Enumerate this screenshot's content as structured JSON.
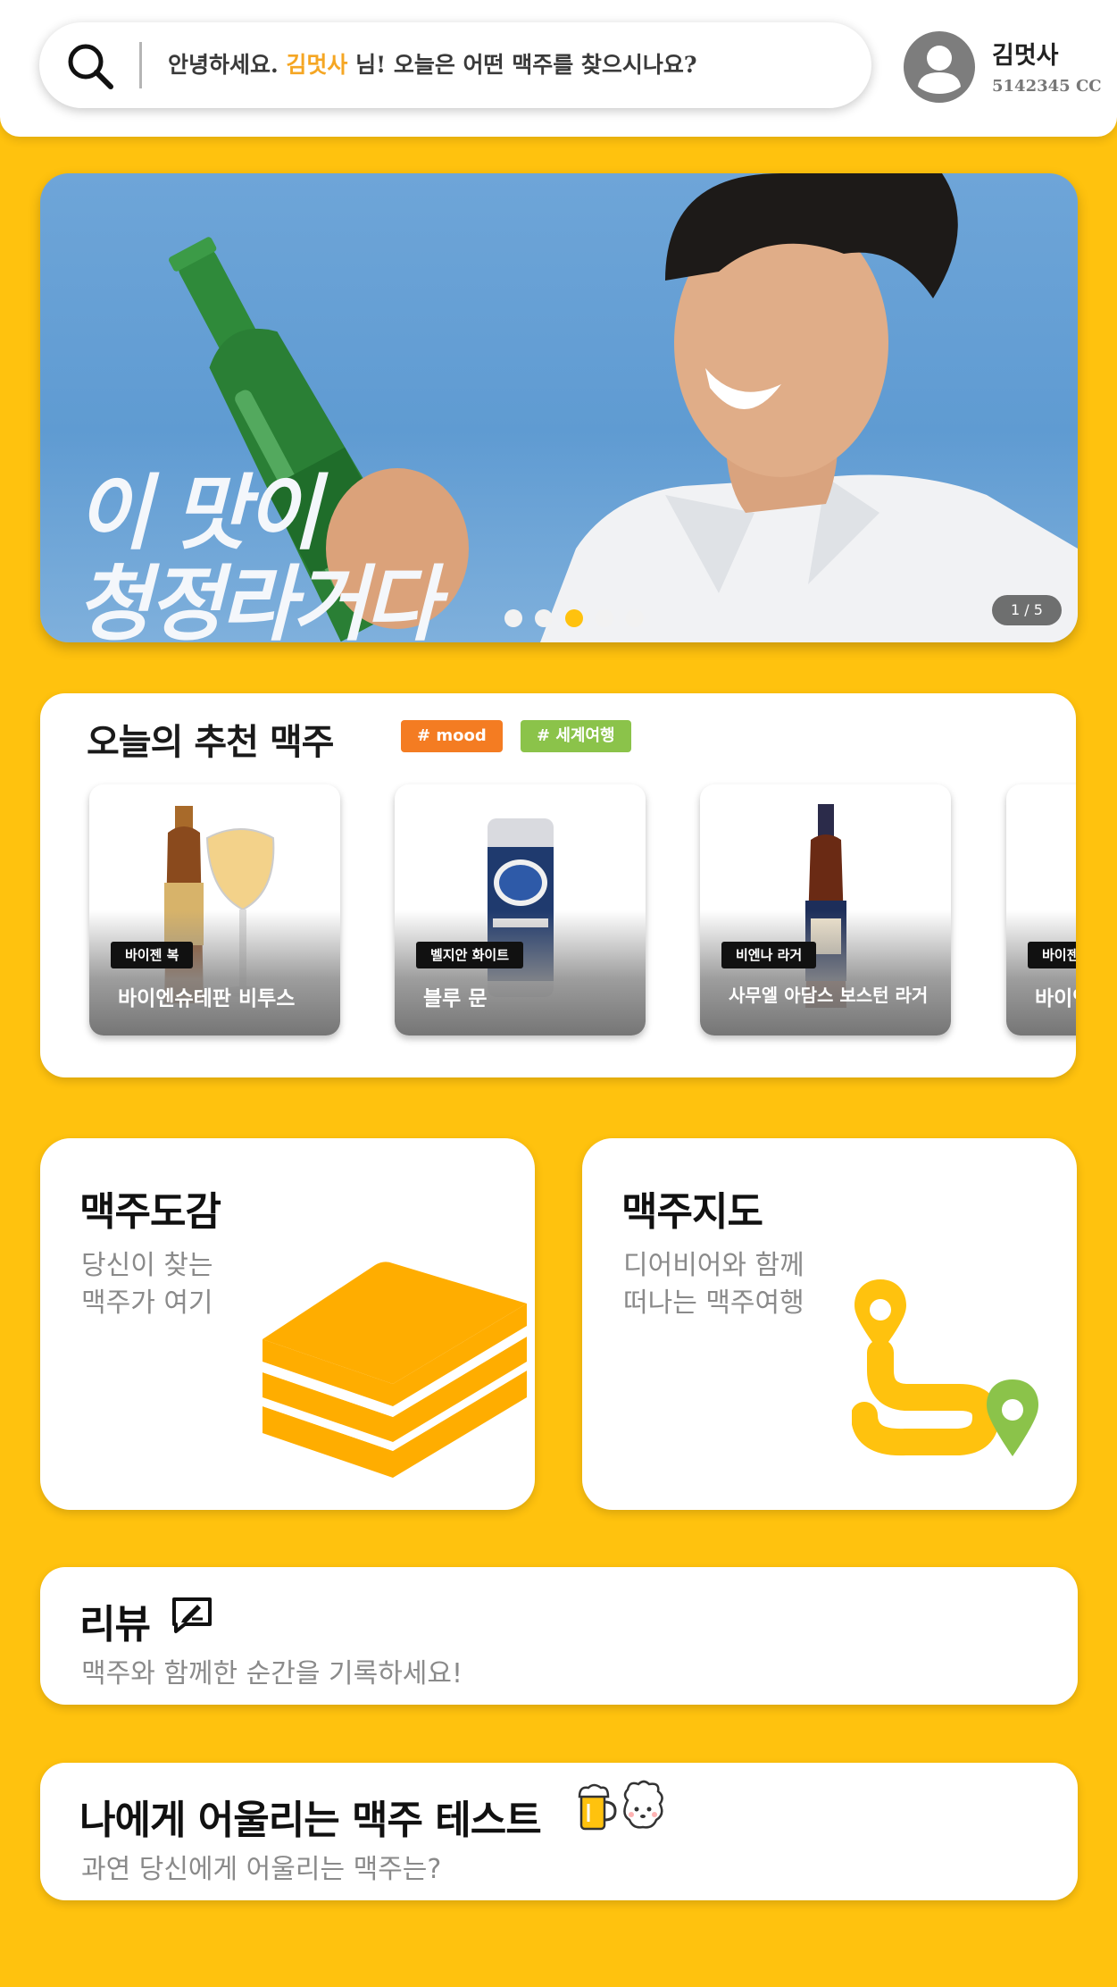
{
  "header": {
    "greeting_prefix": "안녕하세요. ",
    "greeting_name": "김멋사",
    "greeting_suffix": " 님! 오늘은 어떤 맥주를 찾으시나요?",
    "user_name": "김멋사",
    "user_points": "5142345 CC"
  },
  "banner": {
    "headline": "이 맛이\n청정라거다",
    "counter": "1 / 5",
    "active_slide": 3,
    "slides": 5
  },
  "recommend": {
    "title": "오늘의 추천 맥주",
    "tags": [
      "# mood",
      "# 세계여행"
    ],
    "beers": [
      {
        "style": "바이젠 복",
        "name": "바이엔슈테판 비투스"
      },
      {
        "style": "벨지안 화이트",
        "name": "블루 문"
      },
      {
        "style": "비엔나 라거",
        "name": "사무엘 아담스 보스턴 라거"
      },
      {
        "style": "바이젠",
        "name": "바이엔"
      }
    ]
  },
  "features": {
    "book": {
      "title": "맥주도감",
      "desc": "당신이 찾는\n맥주가 여기"
    },
    "map": {
      "title": "맥주지도",
      "desc": "디어비어와 함께\n떠나는 맥주여행"
    }
  },
  "review": {
    "title": "리뷰",
    "subtitle": "맥주와 함께한 순간을 기록하세요!"
  },
  "test": {
    "title": "나에게 어울리는 맥주 테스트",
    "subtitle": "과연 당신에게 어울리는 맥주는?"
  },
  "colors": {
    "accent": "#FFC20E",
    "orange": "#F47C22",
    "green": "#8BC34A",
    "highlight": "#F5A623"
  },
  "icons": [
    "search-icon",
    "avatar-icon",
    "books-icon",
    "map-route-icon",
    "review-pen-icon",
    "beer-mug-icon",
    "sheep-face-icon"
  ]
}
